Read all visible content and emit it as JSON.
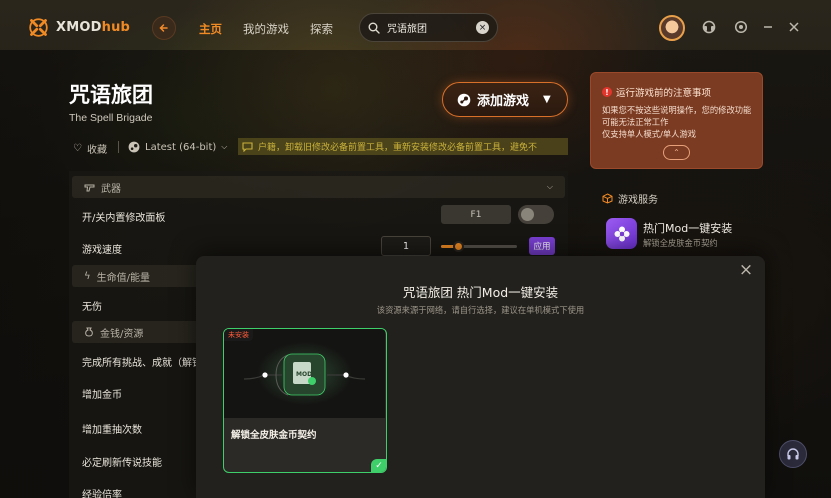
{
  "app": {
    "logo_text": "XMOD",
    "logo_text_accent": "hub",
    "brand_color": "#f08a24"
  },
  "nav": {
    "home": "主页",
    "my_games": "我的游戏",
    "explore": "探索"
  },
  "search": {
    "value": "咒语旅团",
    "placeholder": "咒语旅团",
    "clear_glyph": "×"
  },
  "window_controls": [
    "headset-icon",
    "settings-icon",
    "minimize-icon",
    "close-icon"
  ],
  "game": {
    "title_cn": "咒语旅团",
    "title_en": "The Spell Brigade",
    "add_button": "添加游戏",
    "favorite": "收藏",
    "version": "Latest (64-bit)",
    "notice": "户籍，卸载旧修改必备前置工具，重新安装修改必备前置工具，避免不"
  },
  "mods": {
    "sections": {
      "weapons": "武器",
      "health": "生命值/能量",
      "money": "金钱/资源"
    },
    "rows": {
      "toggle_panel": "开/关内置修改面板",
      "game_speed": "游戏速度",
      "invincible": "无伤",
      "complete_all": "完成所有挑战、成就（解锁",
      "add_gold": "增加金币",
      "reroll": "增加重抽次数",
      "refresh_legend": "必定刷新传说技能",
      "exp_rate": "经验倍率"
    },
    "hotkey": "F1",
    "speed_value": "1",
    "speed_slider_fraction": 0.22,
    "apply_button": "应用"
  },
  "sidebar": {
    "warning_title": "运行游戏前的注意事项",
    "warning_lines": [
      "如果您不按这些说明操作，您的修改功能",
      "可能无法正常工作",
      "仅支持单人模式/单人游戏"
    ],
    "expand_glyph": "⌃",
    "service_title": "游戏服务",
    "service_name": "热门Mod一键安装",
    "service_sub": "解锁全皮肤金币契约"
  },
  "modal": {
    "title": "咒语旅团 热门Mod一键安装",
    "subtitle": "该资源来源于网络，请自行选择，建议在单机模式下使用",
    "card_tag": "未安装",
    "card_name": "解锁全皮肤金币契约",
    "close_glyph": "×",
    "check_glyph": "✓"
  },
  "colors": {
    "accent": "#f08a24",
    "purple": "#7a3fd4",
    "green": "#3fcf6a",
    "warning_bg": "#7a3b22"
  }
}
